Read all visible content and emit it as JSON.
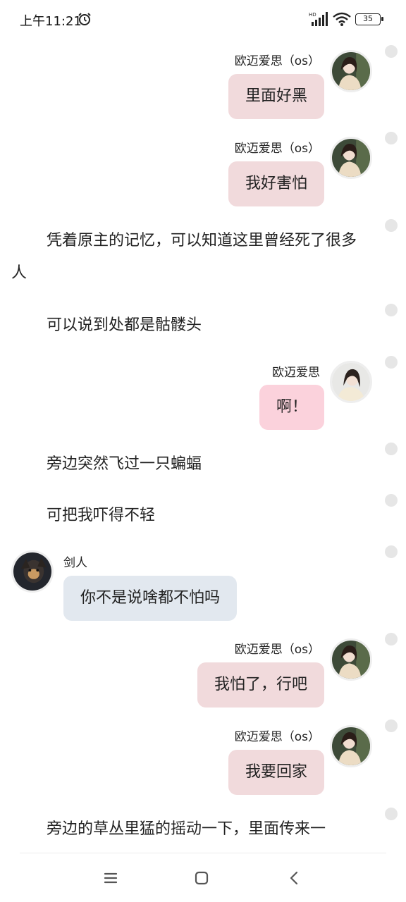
{
  "status_bar": {
    "time": "上午11:21",
    "battery": "35",
    "icons": [
      "alarm-icon",
      "hd-signal-icon",
      "wifi-icon",
      "battery-icon"
    ]
  },
  "messages": [
    {
      "kind": "bubble",
      "side": "right",
      "name": "欧迈爱思（os）",
      "text": "里面好黑"
    },
    {
      "kind": "bubble",
      "side": "right",
      "name": "欧迈爱思（os）",
      "text": "我好害怕"
    },
    {
      "kind": "narration",
      "text": "凭着原主的记忆，可以知道这里曾经死了很多人"
    },
    {
      "kind": "narration",
      "text": "可以说到处都是骷髅头"
    },
    {
      "kind": "bubble",
      "side": "right",
      "name": "欧迈爱思",
      "text": "啊！"
    },
    {
      "kind": "narration",
      "text": "旁边突然飞过一只蝙蝠"
    },
    {
      "kind": "narration",
      "text": "可把我吓得不轻"
    },
    {
      "kind": "bubble",
      "side": "left",
      "name": "剑人",
      "text": "你不是说啥都不怕吗"
    },
    {
      "kind": "bubble",
      "side": "right",
      "name": "欧迈爱思（os）",
      "text": "我怕了，行吧"
    },
    {
      "kind": "bubble",
      "side": "right",
      "name": "欧迈爱思（os）",
      "text": "我要回家"
    },
    {
      "kind": "narration",
      "text": "旁边的草丛里猛的摇动一下，里面传来一"
    }
  ],
  "nav": {
    "icons": [
      "menu-icon",
      "home-icon",
      "back-icon"
    ]
  }
}
